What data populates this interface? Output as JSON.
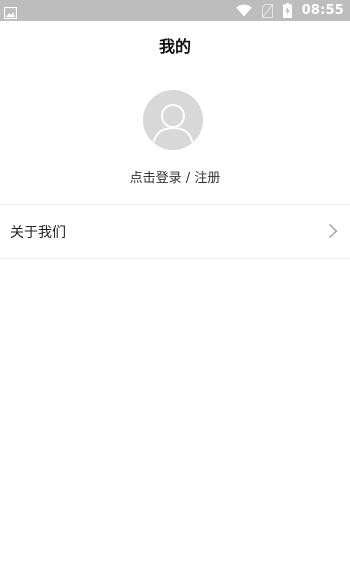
{
  "status_bar": {
    "time": "08:55",
    "icons": [
      "image-icon",
      "wifi-icon",
      "no-sim-icon",
      "battery-charging-icon"
    ],
    "background": "#bdbdbd"
  },
  "header": {
    "title": "我的"
  },
  "profile": {
    "avatar_icon": "default-user-avatar-icon",
    "login_text": "点击登录 / 注册"
  },
  "menu": {
    "items": [
      {
        "label": "关于我们",
        "icon": "chevron-right-icon"
      }
    ]
  }
}
